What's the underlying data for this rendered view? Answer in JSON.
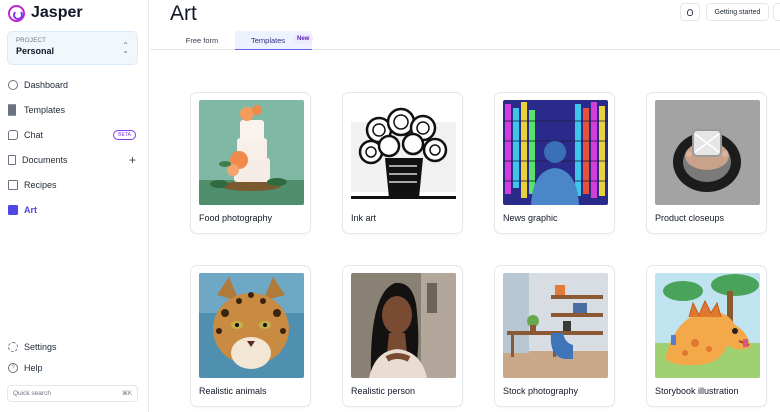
{
  "app": {
    "name": "Jasper",
    "brand_color": "#c026d3",
    "accent_color": "#4f46e5"
  },
  "project": {
    "label": "PROJECT",
    "value": "Personal"
  },
  "sidebar": {
    "items": [
      {
        "label": "Dashboard",
        "icon": "home-icon",
        "active": false
      },
      {
        "label": "Templates",
        "icon": "grid-icon",
        "active": false
      },
      {
        "label": "Chat",
        "icon": "chat-icon",
        "active": false,
        "badge": "BETA"
      },
      {
        "label": "Documents",
        "icon": "document-icon",
        "active": false,
        "action": "+"
      },
      {
        "label": "Recipes",
        "icon": "recipe-icon",
        "active": false
      },
      {
        "label": "Art",
        "icon": "art-icon",
        "active": true
      }
    ],
    "settings_label": "Settings",
    "help_label": "Help",
    "quick_search_placeholder": "Quick search",
    "quick_search_shortcut": "⌘K"
  },
  "header": {
    "title": "Art",
    "tabs": [
      {
        "label": "Free form",
        "active": false
      },
      {
        "label": "Templates",
        "active": true,
        "badge": "New"
      }
    ],
    "getting_started_label": "Getting started",
    "tips_icon": "lightbulb-icon"
  },
  "templates": [
    {
      "label": "Food photography",
      "icon": "cake-image"
    },
    {
      "label": "Ink art",
      "icon": "roses-ink-image"
    },
    {
      "label": "News graphic",
      "icon": "news-graphic-image"
    },
    {
      "label": "Product closeups",
      "icon": "ring-image"
    },
    {
      "label": "Realistic animals",
      "icon": "ocelot-image"
    },
    {
      "label": "Realistic person",
      "icon": "portrait-image"
    },
    {
      "label": "Stock photography",
      "icon": "desk-room-image"
    },
    {
      "label": "Storybook illustration",
      "icon": "dinosaur-image"
    }
  ]
}
